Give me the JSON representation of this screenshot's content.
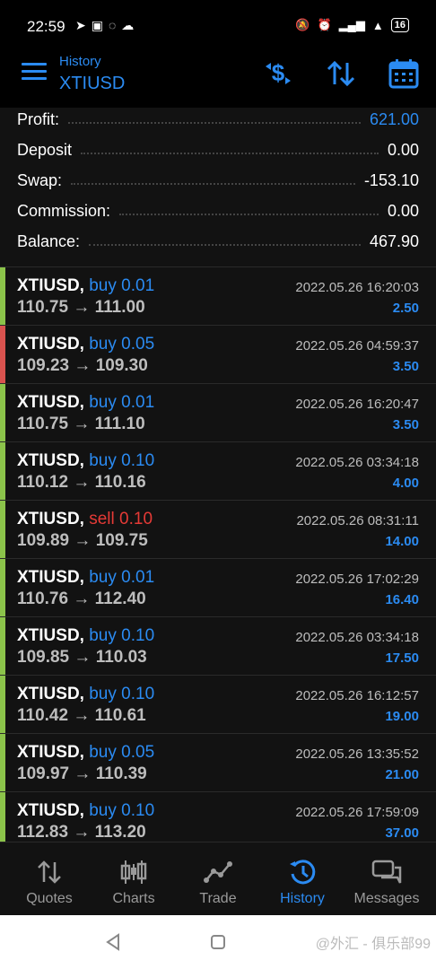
{
  "status": {
    "time": "22:59",
    "battery": "16"
  },
  "header": {
    "subtitle": "History",
    "title": "XTIUSD"
  },
  "summary": [
    {
      "label": "Profit:",
      "value": "621.00",
      "accent": true
    },
    {
      "label": "Deposit",
      "value": "0.00",
      "accent": false
    },
    {
      "label": "Swap:",
      "value": "-153.10",
      "accent": false
    },
    {
      "label": "Commission:",
      "value": "0.00",
      "accent": false
    },
    {
      "label": "Balance:",
      "value": "467.90",
      "accent": false
    }
  ],
  "deals": [
    {
      "symbol": "XTIUSD,",
      "side": "buy",
      "volume": "0.01",
      "open": "110.75",
      "close": "111.00",
      "time": "2022.05.26 16:20:03",
      "profit": "2.50",
      "bar": "#8bc34a"
    },
    {
      "symbol": "XTIUSD,",
      "side": "buy",
      "volume": "0.05",
      "open": "109.23",
      "close": "109.30",
      "time": "2022.05.26 04:59:37",
      "profit": "3.50",
      "bar": "#d9534f"
    },
    {
      "symbol": "XTIUSD,",
      "side": "buy",
      "volume": "0.01",
      "open": "110.75",
      "close": "111.10",
      "time": "2022.05.26 16:20:47",
      "profit": "3.50",
      "bar": "#8bc34a"
    },
    {
      "symbol": "XTIUSD,",
      "side": "buy",
      "volume": "0.10",
      "open": "110.12",
      "close": "110.16",
      "time": "2022.05.26 03:34:18",
      "profit": "4.00",
      "bar": "#8bc34a"
    },
    {
      "symbol": "XTIUSD,",
      "side": "sell",
      "volume": "0.10",
      "open": "109.89",
      "close": "109.75",
      "time": "2022.05.26 08:31:11",
      "profit": "14.00",
      "bar": "#8bc34a"
    },
    {
      "symbol": "XTIUSD,",
      "side": "buy",
      "volume": "0.01",
      "open": "110.76",
      "close": "112.40",
      "time": "2022.05.26 17:02:29",
      "profit": "16.40",
      "bar": "#8bc34a"
    },
    {
      "symbol": "XTIUSD,",
      "side": "buy",
      "volume": "0.10",
      "open": "109.85",
      "close": "110.03",
      "time": "2022.05.26 03:34:18",
      "profit": "17.50",
      "bar": "#8bc34a"
    },
    {
      "symbol": "XTIUSD,",
      "side": "buy",
      "volume": "0.10",
      "open": "110.42",
      "close": "110.61",
      "time": "2022.05.26 16:12:57",
      "profit": "19.00",
      "bar": "#8bc34a"
    },
    {
      "symbol": "XTIUSD,",
      "side": "buy",
      "volume": "0.05",
      "open": "109.97",
      "close": "110.39",
      "time": "2022.05.26 13:35:52",
      "profit": "21.00",
      "bar": "#8bc34a"
    },
    {
      "symbol": "XTIUSD,",
      "side": "buy",
      "volume": "0.10",
      "open": "112.83",
      "close": "113.20",
      "time": "2022.05.26 17:59:09",
      "profit": "37.00",
      "bar": "#8bc34a"
    }
  ],
  "tabs": [
    {
      "label": "Quotes",
      "icon": "quotes-icon",
      "active": false
    },
    {
      "label": "Charts",
      "icon": "charts-icon",
      "active": false
    },
    {
      "label": "Trade",
      "icon": "trade-icon",
      "active": false
    },
    {
      "label": "History",
      "icon": "history-icon",
      "active": true
    },
    {
      "label": "Messages",
      "icon": "messages-icon",
      "active": false
    }
  ],
  "watermark": "@外汇 - 俱乐部99",
  "colors": {
    "accent": "#2b8bf2",
    "sell": "#e53a36",
    "bar_green": "#8bc34a",
    "bar_red": "#d9534f"
  }
}
